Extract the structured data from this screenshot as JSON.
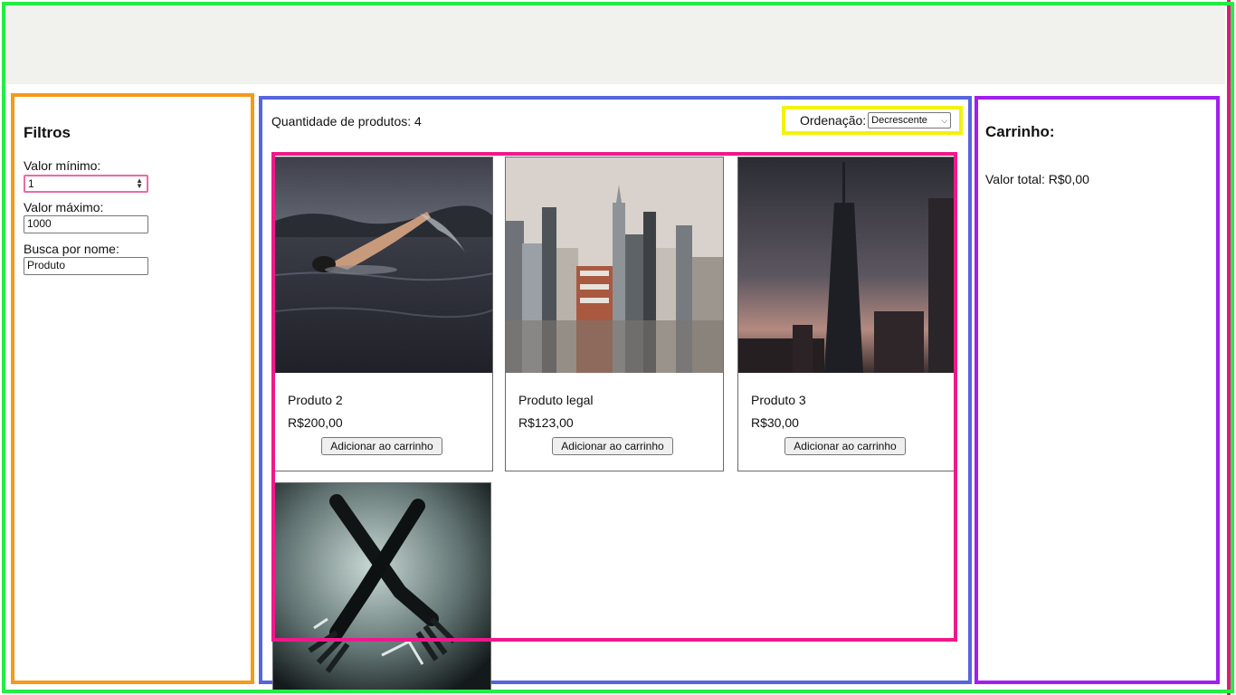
{
  "filters": {
    "title": "Filtros",
    "min_label": "Valor mínimo:",
    "min_value": "1",
    "max_label": "Valor máximo:",
    "max_value": "1000",
    "name_label": "Busca por nome:",
    "name_value": "Produto"
  },
  "main": {
    "quantity_text": "Quantidade de produtos: 4",
    "sort_label": "Ordenação:",
    "sort_selected": "Decrescente"
  },
  "products": [
    {
      "name": "Produto 2",
      "price": "R$200,00",
      "button": "Adicionar ao carrinho",
      "image": "swimmer-photo"
    },
    {
      "name": "Produto legal",
      "price": "R$123,00",
      "button": "Adicionar ao carrinho",
      "image": "city-skyline-photo"
    },
    {
      "name": "Produto 3",
      "price": "R$30,00",
      "button": "Adicionar ao carrinho",
      "image": "tower-photo"
    },
    {
      "image": "forks-photo"
    }
  ],
  "cart": {
    "title": "Carrinho:",
    "total": "Valor total: R$0,00"
  },
  "colors": {
    "outer_frame": "#22ee44",
    "filters_frame": "#f59a1a",
    "main_frame": "#5566dd",
    "sort_frame": "#f2f20a",
    "grid_frame": "#f0188a",
    "cart_frame": "#a21ef0"
  }
}
